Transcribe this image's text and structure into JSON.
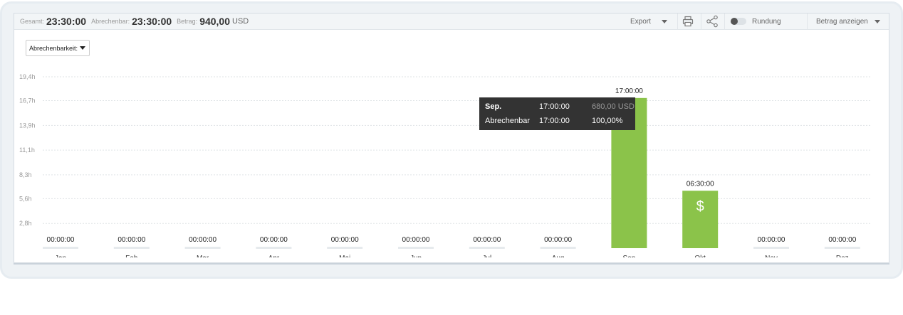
{
  "summary": {
    "total_label": "Gesamt:",
    "total_value": "23:30:00",
    "billable_label": "Abrechenbar:",
    "billable_value": "23:30:00",
    "amount_label": "Betrag:",
    "amount_value": "940,00",
    "amount_currency": "USD"
  },
  "toolbar": {
    "export_label": "Export",
    "rounding_label": "Rundung",
    "show_amount_label": "Betrag anzeigen",
    "rounding_on": false
  },
  "filter": {
    "billability_label": "Abrechenbarkeit:"
  },
  "colors": {
    "bar": "#8bc34a",
    "empty_bar": "#e6eaed",
    "tooltip_bg": "#333333"
  },
  "chart_data": {
    "type": "bar",
    "categories": [
      "Jan",
      "Feb",
      "Mar",
      "Apr",
      "Mai",
      "Jun",
      "Jul",
      "Aug",
      "Sep",
      "Okt",
      "Nov",
      "Dez"
    ],
    "values": [
      0,
      0,
      0,
      0,
      0,
      0,
      0,
      0,
      17.0,
      6.5,
      0,
      0
    ],
    "value_labels": [
      "00:00:00",
      "00:00:00",
      "00:00:00",
      "00:00:00",
      "00:00:00",
      "00:00:00",
      "00:00:00",
      "00:00:00",
      "17:00:00",
      "06:30:00",
      "00:00:00",
      "00:00:00"
    ],
    "y_ticks": [
      2.8,
      5.6,
      8.3,
      11.1,
      13.9,
      16.7,
      19.4
    ],
    "y_tick_labels": [
      "2,8h",
      "5,6h",
      "8,3h",
      "11,1h",
      "13,9h",
      "16,7h",
      "19,4h"
    ],
    "ylim": [
      0,
      19.4
    ],
    "grid": true,
    "bar_icons": [
      null,
      null,
      null,
      null,
      null,
      null,
      null,
      null,
      null,
      "dollar-icon",
      null,
      null
    ]
  },
  "tooltip": {
    "month": "Sep.",
    "time": "17:00:00",
    "amount": "680,00 USD",
    "billable_label": "Abrechenbar",
    "billable_time": "17:00:00",
    "billable_pct": "100,00%"
  }
}
